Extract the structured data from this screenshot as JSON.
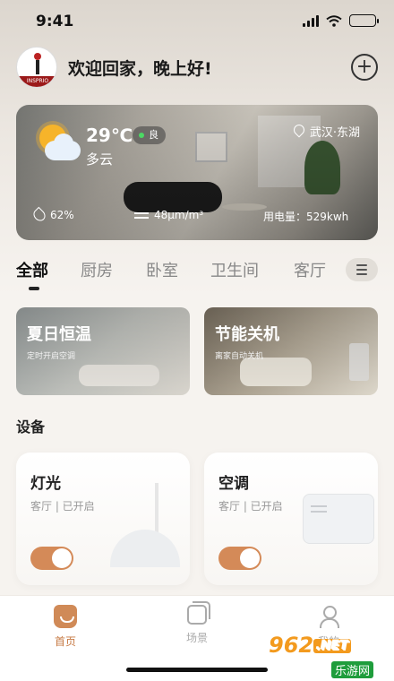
{
  "status_bar": {
    "time": "9:41"
  },
  "header": {
    "brand_band": "INSPRIO",
    "greeting": "欢迎回家，晚上好!",
    "add_symbol": "+"
  },
  "weather": {
    "temperature": "29℃",
    "air_quality": "良",
    "condition": "多云",
    "location": "武汉·东湖",
    "humidity": "62%",
    "pm": "48μm/m³",
    "power_usage": "用电量：529kwh"
  },
  "tabs": [
    {
      "label": "全部",
      "active": true
    },
    {
      "label": "厨房",
      "active": false
    },
    {
      "label": "卧室",
      "active": false
    },
    {
      "label": "卫生间",
      "active": false
    },
    {
      "label": "客厅",
      "active": false
    }
  ],
  "scenes": [
    {
      "title": "夏日恒温",
      "subtitle": "定时开启空调"
    },
    {
      "title": "节能关机",
      "subtitle": "离家自动关机"
    }
  ],
  "devices_section": {
    "title": "设备"
  },
  "devices": [
    {
      "name": "灯光",
      "status": "客厅 | 已开启",
      "on": true
    },
    {
      "name": "空调",
      "status": "客厅 | 已开启",
      "on": true
    }
  ],
  "tabbar": [
    {
      "label": "首页",
      "icon": "home-icon",
      "active": true
    },
    {
      "label": "场景",
      "icon": "scene-icon",
      "active": false
    },
    {
      "label": "我的",
      "icon": "user-icon",
      "active": false
    }
  ],
  "watermark": {
    "logo": "962",
    "net": ".NET",
    "sub": "乐游网"
  },
  "colors": {
    "accent": "#d48a58",
    "tab_active": "#c77a44",
    "background": "#f6f3ef"
  }
}
